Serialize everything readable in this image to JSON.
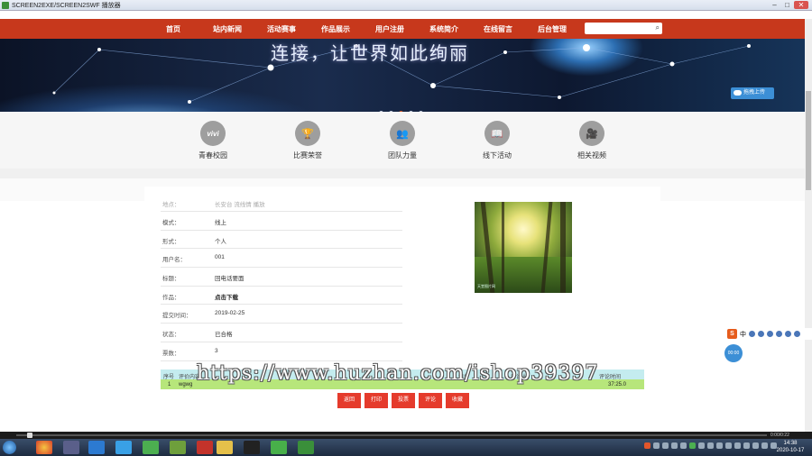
{
  "window": {
    "title": "SCREEN2EXE/SCREEN2SWF 播放器"
  },
  "nav": {
    "items": [
      "首页",
      "站内新闻",
      "活动赛事",
      "作品展示",
      "用户注册",
      "系统简介",
      "在线留言",
      "后台管理"
    ],
    "search_placeholder": ""
  },
  "banner": {
    "slogan": "连接，让世界如此绚丽",
    "upload_label": "拖拽上传"
  },
  "features": [
    {
      "label": "青春校园",
      "icon": "vivi-badge-icon",
      "glyph": "vivi"
    },
    {
      "label": "比赛荣誉",
      "icon": "trophy-icon",
      "glyph": "🏆"
    },
    {
      "label": "团队力量",
      "icon": "team-icon",
      "glyph": "👥"
    },
    {
      "label": "线下活动",
      "icon": "open-book-icon",
      "glyph": "📖"
    },
    {
      "label": "相关视频",
      "icon": "video-camera-icon",
      "glyph": "🎥"
    }
  ],
  "detail": {
    "partial_row": {
      "key": "地点：",
      "value": "长安台 流线情 播放"
    },
    "rows": [
      {
        "key": "模式：",
        "value": "线上"
      },
      {
        "key": "形式：",
        "value": "个人"
      },
      {
        "key": "用户名：",
        "value": "001"
      },
      {
        "key": "标题：",
        "value": "回电话要面"
      },
      {
        "key": "作品：",
        "value": "点击下载"
      },
      {
        "key": "提交时间：",
        "value": "2019-02-25"
      },
      {
        "key": "状态：",
        "value": "已合格"
      },
      {
        "key": "票数：",
        "value": "3"
      }
    ],
    "photo_caption": "天堂图片网"
  },
  "reviews": {
    "headers": {
      "no": "序号",
      "content": "评价内容",
      "score": "评分",
      "reviewer": "评论人",
      "time": "评论时间"
    },
    "rows": [
      {
        "no": "1",
        "content": "wgwg",
        "score": "",
        "reviewer": "",
        "time": "37:25.0"
      }
    ]
  },
  "buttons": [
    "返回",
    "打印",
    "投票",
    "评论",
    "收藏"
  ],
  "watermark": "https://www.huzhan.com/ishop39397",
  "ime": {
    "badge": "S",
    "mode": "中"
  },
  "float_button": "00:00",
  "player": {
    "time": "0:00/0:22"
  },
  "clock": {
    "time": "14:38",
    "date": "2020-10-17"
  },
  "colors": {
    "nav": "#c7381c",
    "button": "#e53b2c",
    "review_header": "#c4ecef",
    "review_row": "#b7e67b"
  }
}
